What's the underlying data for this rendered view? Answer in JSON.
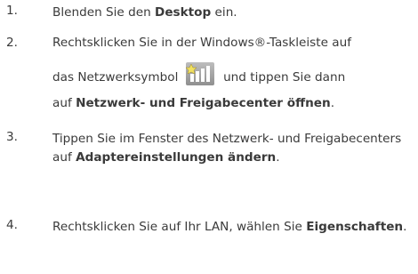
{
  "steps": [
    {
      "num": "1.",
      "p1": "Blenden Sie den ",
      "b1": "Desktop",
      "p2": " ein."
    },
    {
      "num": "2.",
      "l1": "Rechtsklicken Sie in der Windows®-Taskleiste auf",
      "l2a": "das Netzwerksymbol",
      "l2b": "und tippen Sie dann",
      "l3a": "auf ",
      "l3b": "Netzwerk- und Freigabecenter öffnen",
      "l3c": ".",
      "icon": "network-icon"
    },
    {
      "num": "3.",
      "p1": "Tippen Sie im Fenster des Netzwerk- und Freigabecenters auf ",
      "b1": "Adaptereinstellungen ändern",
      "p2": "."
    },
    {
      "num": "4.",
      "p1": "Rechtsklicken Sie auf Ihr LAN, wählen Sie ",
      "b1": "Eigenschaften",
      "p2": "."
    }
  ]
}
